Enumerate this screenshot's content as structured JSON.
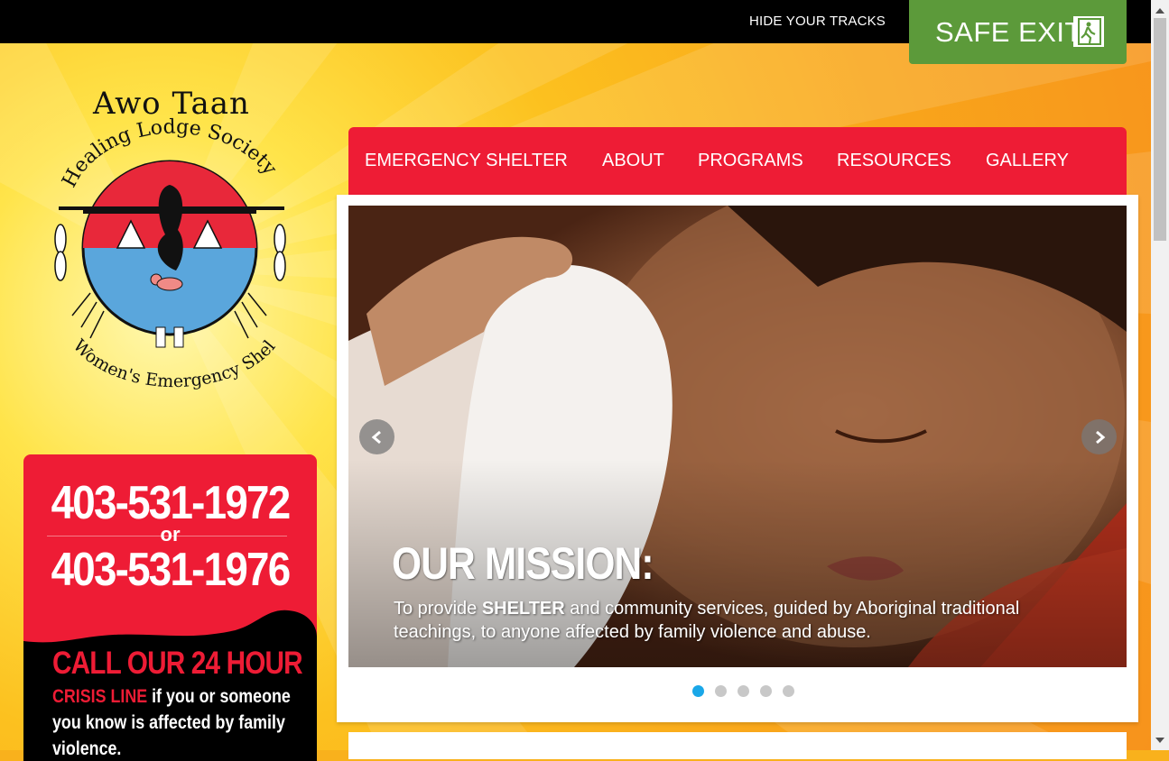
{
  "topbar": {
    "hide_tracks": "HIDE YOUR TRACKS",
    "safe_exit": "SAFE EXIT",
    "safe_exit_color": "#5c9a3a"
  },
  "logo": {
    "title": "Awo Taan",
    "arc_top": "Healing Lodge Society",
    "arc_bottom": "Women's Emergency Shelter"
  },
  "crisis": {
    "phone1": "403-531-1972",
    "or": "or",
    "phone2": "403-531-1976",
    "heading": "CALL OUR 24 HOUR",
    "line_label": "CRISIS LINE",
    "body": " if you or someone you know is affected by family violence."
  },
  "nav": {
    "items": [
      "EMERGENCY SHELTER",
      "ABOUT",
      "PROGRAMS",
      "RESOURCES",
      "GALLERY"
    ],
    "color": "#ee1c35"
  },
  "slider": {
    "mission_title": "OUR MISSION:",
    "mission_pre": "To provide ",
    "mission_bold": "SHELTER",
    "mission_post": " and community services, guided by Aboriginal traditional teachings, to anyone affected by family violence and abuse.",
    "prev_icon": "chevron-left-icon",
    "next_icon": "chevron-right-icon",
    "active_dot": 1,
    "dot_count": 5,
    "active_dot_color": "#1aa7e8"
  }
}
